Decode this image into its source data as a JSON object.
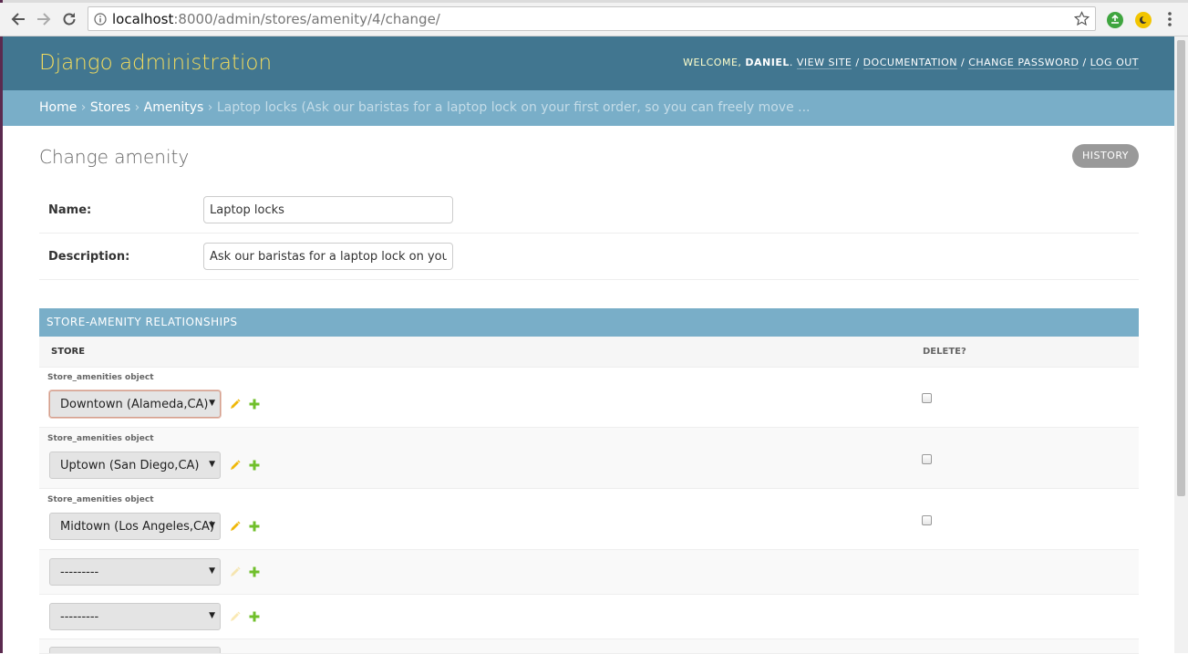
{
  "browser": {
    "url_host": "localhost",
    "url_rest": ":8000/admin/stores/amenity/4/change/"
  },
  "header": {
    "branding": "Django administration",
    "welcome": "Welcome,",
    "username": "Daniel",
    "links": [
      "View site",
      "Documentation",
      "Change password",
      "Log out"
    ]
  },
  "breadcrumbs": {
    "items": [
      "Home",
      "Stores",
      "Amenitys"
    ],
    "current": "Laptop locks (Ask our baristas for a laptop lock on your first order, so you can freely move ..."
  },
  "page": {
    "title": "Change amenity",
    "history_label": "History"
  },
  "form": {
    "name_label": "Name:",
    "name_value": "Laptop locks",
    "description_label": "Description:",
    "description_value": "Ask our baristas for a laptop lock on your first order, so you can freely move"
  },
  "inline": {
    "caption": "Store-amenity relationships",
    "col_store": "Store",
    "col_delete": "Delete?",
    "rows": [
      {
        "label": "Store_amenities object",
        "store": "Downtown (Alameda,CA)"
      },
      {
        "label": "Store_amenities object",
        "store": "Uptown (San Diego,CA)"
      },
      {
        "label": "Store_amenities object",
        "store": "Midtown (Los Angeles,CA)"
      },
      {
        "label": "",
        "store": "---------"
      },
      {
        "label": "",
        "store": "---------"
      }
    ]
  },
  "colors": {
    "header_bg": "#417690",
    "breadcrumb_bg": "#79aec8",
    "branding": "#f5dd5d",
    "edit_icon": "#efb80b",
    "add_icon": "#70bf2b"
  },
  "icons": [
    "back-icon",
    "forward-icon",
    "reload-icon",
    "info-icon",
    "star-icon",
    "pencil-icon",
    "plus-icon",
    "menu-dots-icon"
  ]
}
